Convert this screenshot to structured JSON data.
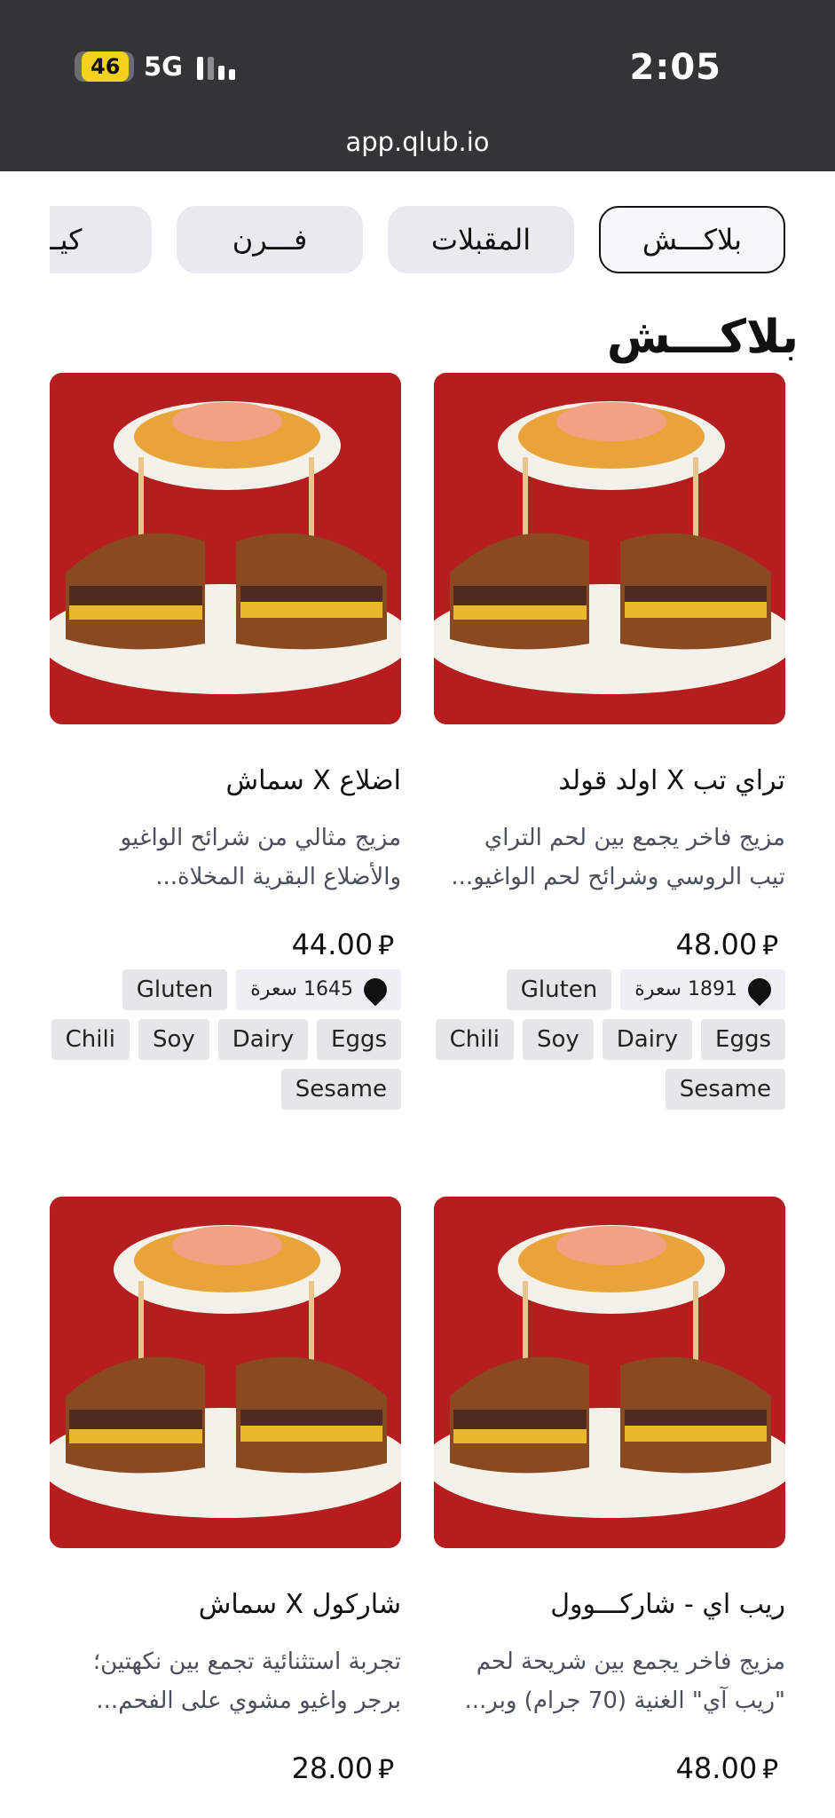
{
  "status_bar": {
    "battery": "46",
    "network": "5G",
    "time": "2:05"
  },
  "browser": {
    "url": "app.qlub.io"
  },
  "tabs": [
    {
      "label": "بلاكـــش",
      "active": true
    },
    {
      "label": "المقبلات",
      "active": false
    },
    {
      "label": "فـــرن",
      "active": false
    },
    {
      "label": "كيـــ",
      "active": false
    }
  ],
  "section_title": "بلاكـــش",
  "currency_symbol": "⃁",
  "items": [
    {
      "name": "تراي تب X اولد قولد",
      "desc_line1": "مزيج فاخر يجمع بين لحم التراي",
      "desc_line2": "تيب الروسي وشرائح لحم الواغيو...",
      "price": "48.00",
      "calories": "1891 سعرة",
      "allergens": [
        "Gluten",
        "Eggs",
        "Dairy",
        "Soy",
        "Chili",
        "Sesame"
      ]
    },
    {
      "name": "اضلاع X سماش",
      "desc_line1": "مزيج مثالي من شرائح الواغيو",
      "desc_line2": "والأضلاع البقرية المخلاة...",
      "price": "44.00",
      "calories": "1645 سعرة",
      "allergens": [
        "Gluten",
        "Eggs",
        "Dairy",
        "Soy",
        "Chili",
        "Sesame"
      ]
    },
    {
      "name": "ريب اي - شاركـــوول",
      "desc_line1": "مزيج فاخر يجمع بين شريحة لحم",
      "desc_line2": "\"ريب آي\" الغنية (70 جرام) وبر...",
      "price": "48.00"
    },
    {
      "name": "شاركول X سماش",
      "desc_line1": "تجربة استثنائية تجمع بين نكهتين؛",
      "desc_line2": "برجر واغيو مشوي على الفحم...",
      "price": "28.00"
    }
  ],
  "colors": {
    "topbar": "#323436",
    "photo_background": "#b51d1e",
    "tab_background": "#e9eaef",
    "tag_background": "#e6e6e8",
    "description_text": "#4b4f5c"
  }
}
